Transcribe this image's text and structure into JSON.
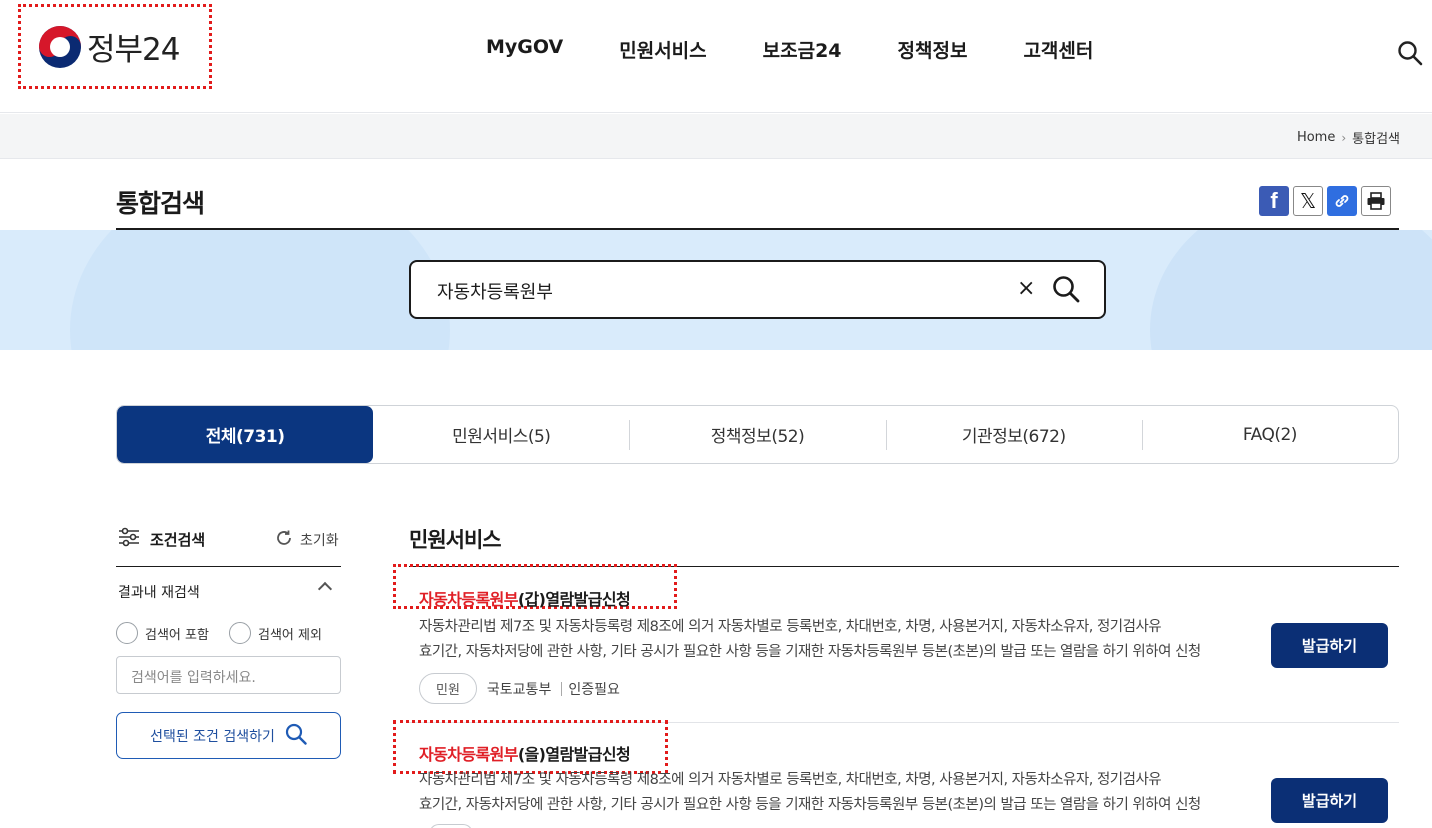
{
  "header": {
    "logo_text": "정부24",
    "nav": [
      "MyGOV",
      "민원서비스",
      "보조금24",
      "정책정보",
      "고객센터"
    ]
  },
  "breadcrumb": {
    "home": "Home",
    "current": "통합검색"
  },
  "page": {
    "title": "통합검색"
  },
  "share": {
    "facebook_icon": "facebook-icon",
    "x_icon": "x-icon",
    "link_icon": "link-icon",
    "print_icon": "print-icon"
  },
  "search": {
    "value": "자동차등록원부",
    "clear": "×"
  },
  "tabs": [
    {
      "label": "전체(731)",
      "active": true
    },
    {
      "label": "민원서비스(5)",
      "active": false
    },
    {
      "label": "정책정보(52)",
      "active": false
    },
    {
      "label": "기관정보(672)",
      "active": false
    },
    {
      "label": "FAQ(2)",
      "active": false
    }
  ],
  "filter": {
    "title": "조건검색",
    "reset": "초기화",
    "refine_label": "결과내 재검색",
    "include": "검색어 포함",
    "exclude": "검색어 제외",
    "placeholder": "검색어를 입력하세요.",
    "apply": "선택된 조건 검색하기"
  },
  "results": {
    "section_title": "민원서비스",
    "items": [
      {
        "title_hl": "자동차등록원부",
        "title_rest": "(갑)열람발급신청",
        "desc1": "자동차관리법 제7조 및 자동차등록령 제8조에 의거 자동차별로 등록번호, 차대번호, 차명, 사용본거지, 자동차소유자, 정기검사유",
        "desc2": "효기간, 자동차저당에 관한 사항, 기타 공시가 필요한 사항 등을 기재한 자동차등록원부 등본(초본)의 발급 또는 열람을 하기 위하여 신청",
        "tag": "민원",
        "agency": "국토교통부",
        "auth": "인증필요",
        "button": "발급하기"
      },
      {
        "title_hl": "자동차등록원부",
        "title_rest": "(을)열람발급신청",
        "desc1": "자동차관리법 제7조 및 자동차등록령 제8조에 의거 자동차별로 등록번호, 차대번호, 차명, 사용본거지, 자동차소유자, 정기검사유",
        "desc2": "효기간, 자동차저당에 관한 사항, 기타 공시가 필요한 사항 등을 기재한 자동차등록원부 등본(초본)의 발급 또는 열람을 하기 위하여 신청",
        "button": "발급하기"
      }
    ]
  },
  "colors": {
    "primary": "#0b3680",
    "highlight": "#e01f26",
    "band": "#d9ebfb"
  }
}
